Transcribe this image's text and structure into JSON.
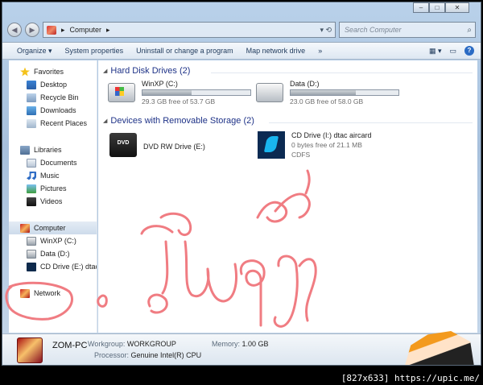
{
  "address": {
    "crumbs": [
      "Computer"
    ],
    "search_placeholder": "Search Computer"
  },
  "toolbar": {
    "items": [
      "Organize ▾",
      "System properties",
      "Uninstall or change a program",
      "Map network drive",
      "»"
    ]
  },
  "sidebar": {
    "favorites": {
      "label": "Favorites",
      "items": [
        "Desktop",
        "Recycle Bin",
        "Downloads",
        "Recent Places"
      ]
    },
    "libraries": {
      "label": "Libraries",
      "items": [
        "Documents",
        "Music",
        "Pictures",
        "Videos"
      ]
    },
    "computer": {
      "label": "Computer",
      "items": [
        "WinXP (C:)",
        "Data (D:)",
        "CD Drive (E:) dtac"
      ]
    },
    "network": {
      "label": "Network"
    }
  },
  "content": {
    "hdd_group": "Hard Disk Drives (2)",
    "removable_group": "Devices with Removable Storage (2)",
    "drives": [
      {
        "name": "WinXP (C:)",
        "free": "29.3 GB free of 53.7 GB",
        "used_fraction": 0.455
      },
      {
        "name": "Data (D:)",
        "free": "23.0 GB free of 58.0 GB",
        "used_fraction": 0.603
      }
    ],
    "dvd": {
      "name": "DVD RW Drive (E:)",
      "icon_text": "DVD"
    },
    "cd": {
      "name": "CD Drive (I:) dtac aircard",
      "free": "0 bytes free of 21.1 MB",
      "fs": "CDFS"
    }
  },
  "details": {
    "pc_name": "ZOM-PC",
    "workgroup_label": "Workgroup:",
    "workgroup": "WORKGROUP",
    "memory_label": "Memory:",
    "memory": "1.00 GB",
    "processor_label": "Processor:",
    "processor": "Genuine Intel(R) CPU"
  },
  "footer_text": "[827x633] https://upic.me/",
  "colors": {
    "group_title": "#1e3287",
    "scribble": "#f07c82"
  }
}
